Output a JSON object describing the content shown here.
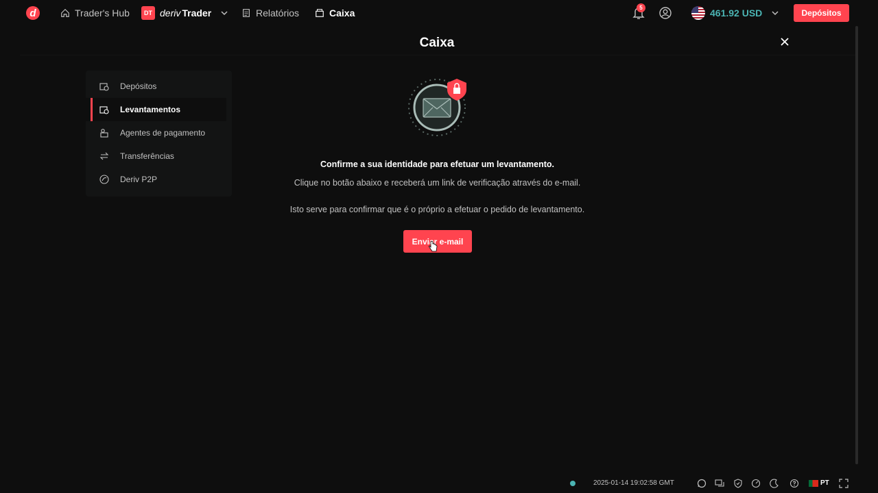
{
  "header": {
    "logo_letter": "d",
    "traders_hub": "Trader's Hub",
    "dt_badge": "DT",
    "deriv_word": "deriv",
    "trader_word": "Trader",
    "reports": "Relatórios",
    "cashier": "Caixa",
    "notification_count": "5",
    "balance": "461.92 USD",
    "deposit_button": "Depósitos"
  },
  "modal": {
    "title": "Caixa"
  },
  "sidebar": {
    "items": [
      {
        "label": "Depósitos",
        "icon": "deposit-icon"
      },
      {
        "label": "Levantamentos",
        "icon": "withdrawal-icon",
        "active": true
      },
      {
        "label": "Agentes de pagamento",
        "icon": "payment-agent-icon"
      },
      {
        "label": "Transferências",
        "icon": "transfer-icon"
      },
      {
        "label": "Deriv P2P",
        "icon": "p2p-icon"
      }
    ]
  },
  "main": {
    "headline": "Confirme a sua identidade para efetuar um levantamento.",
    "description1": "Clique no botão abaixo e receberá um link de verificação através do e-mail.",
    "description2": "Isto serve para confirmar que é o próprio a efetuar o pedido de levantamento.",
    "send_button": "Enviar e-mail"
  },
  "footer": {
    "timestamp": "2025-01-14 19:02:58 GMT",
    "language": "PT"
  },
  "colors": {
    "accent": "#ff444f",
    "balance": "#4bb4b3",
    "background": "#0e0e0e"
  }
}
